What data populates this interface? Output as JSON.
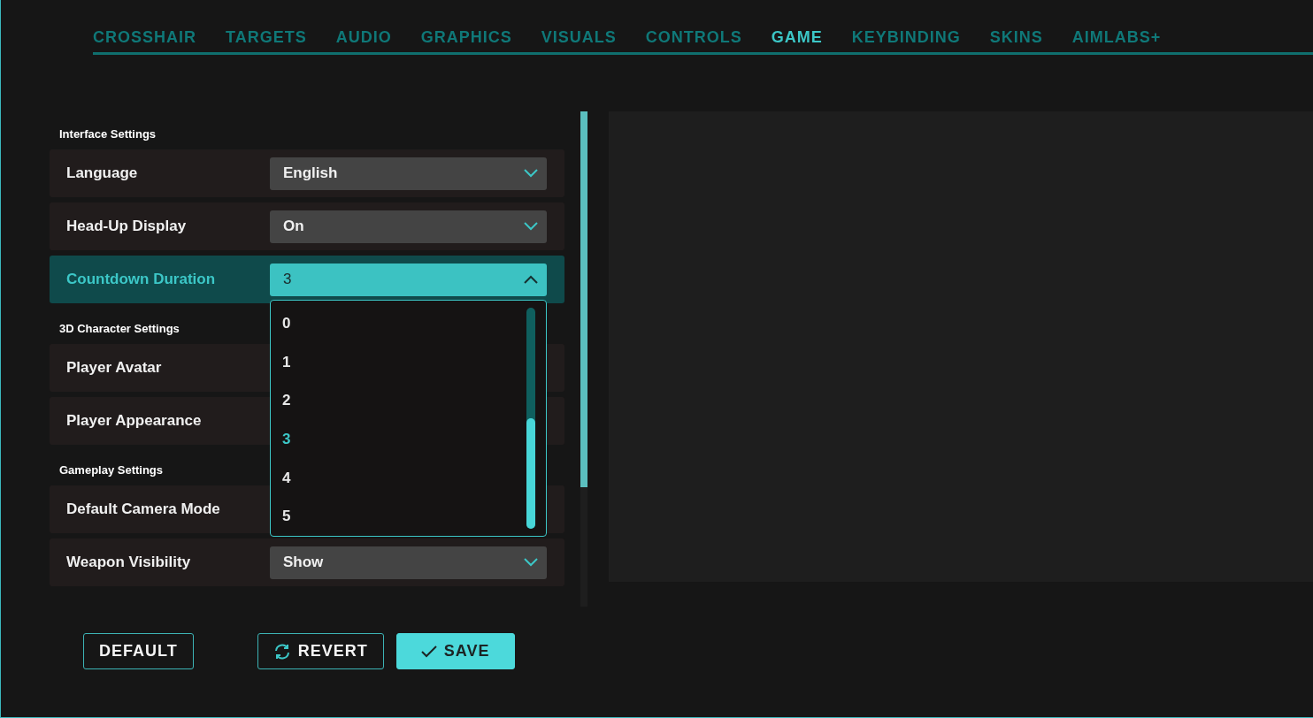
{
  "tabs": [
    {
      "label": "CROSSHAIR",
      "selected": false
    },
    {
      "label": "TARGETS",
      "selected": false
    },
    {
      "label": "AUDIO",
      "selected": false
    },
    {
      "label": "GRAPHICS",
      "selected": false
    },
    {
      "label": "VISUALS",
      "selected": false
    },
    {
      "label": "CONTROLS",
      "selected": false
    },
    {
      "label": "GAME",
      "selected": true
    },
    {
      "label": "KEYBINDING",
      "selected": false
    },
    {
      "label": "SKINS",
      "selected": false
    },
    {
      "label": "AIMLABS+",
      "selected": false
    }
  ],
  "sections": [
    {
      "title": "Interface Settings",
      "rows": [
        {
          "label": "Language",
          "value": "English",
          "expanded": false
        },
        {
          "label": "Head-Up Display",
          "value": "On",
          "expanded": false
        },
        {
          "label": "Countdown Duration",
          "value": "3",
          "expanded": true,
          "options": [
            {
              "label": "0",
              "selected": false
            },
            {
              "label": "1",
              "selected": false
            },
            {
              "label": "2",
              "selected": false
            },
            {
              "label": "3",
              "selected": true
            },
            {
              "label": "4",
              "selected": false
            },
            {
              "label": "5",
              "selected": false
            }
          ]
        }
      ]
    },
    {
      "title": "3D Character Settings",
      "rows": [
        {
          "label": "Player Avatar",
          "expanded": false
        },
        {
          "label": "Player Appearance",
          "expanded": false
        }
      ]
    },
    {
      "title": "Gameplay Settings",
      "rows": [
        {
          "label": "Default Camera Mode",
          "expanded": false
        },
        {
          "label": "Weapon Visibility",
          "value": "Show",
          "expanded": false
        }
      ]
    }
  ],
  "buttons": [
    {
      "kind": "outline",
      "label": "DEFAULT"
    },
    {
      "kind": "revert",
      "label": "REVERT"
    },
    {
      "kind": "primary",
      "label": "SAVE"
    }
  ]
}
